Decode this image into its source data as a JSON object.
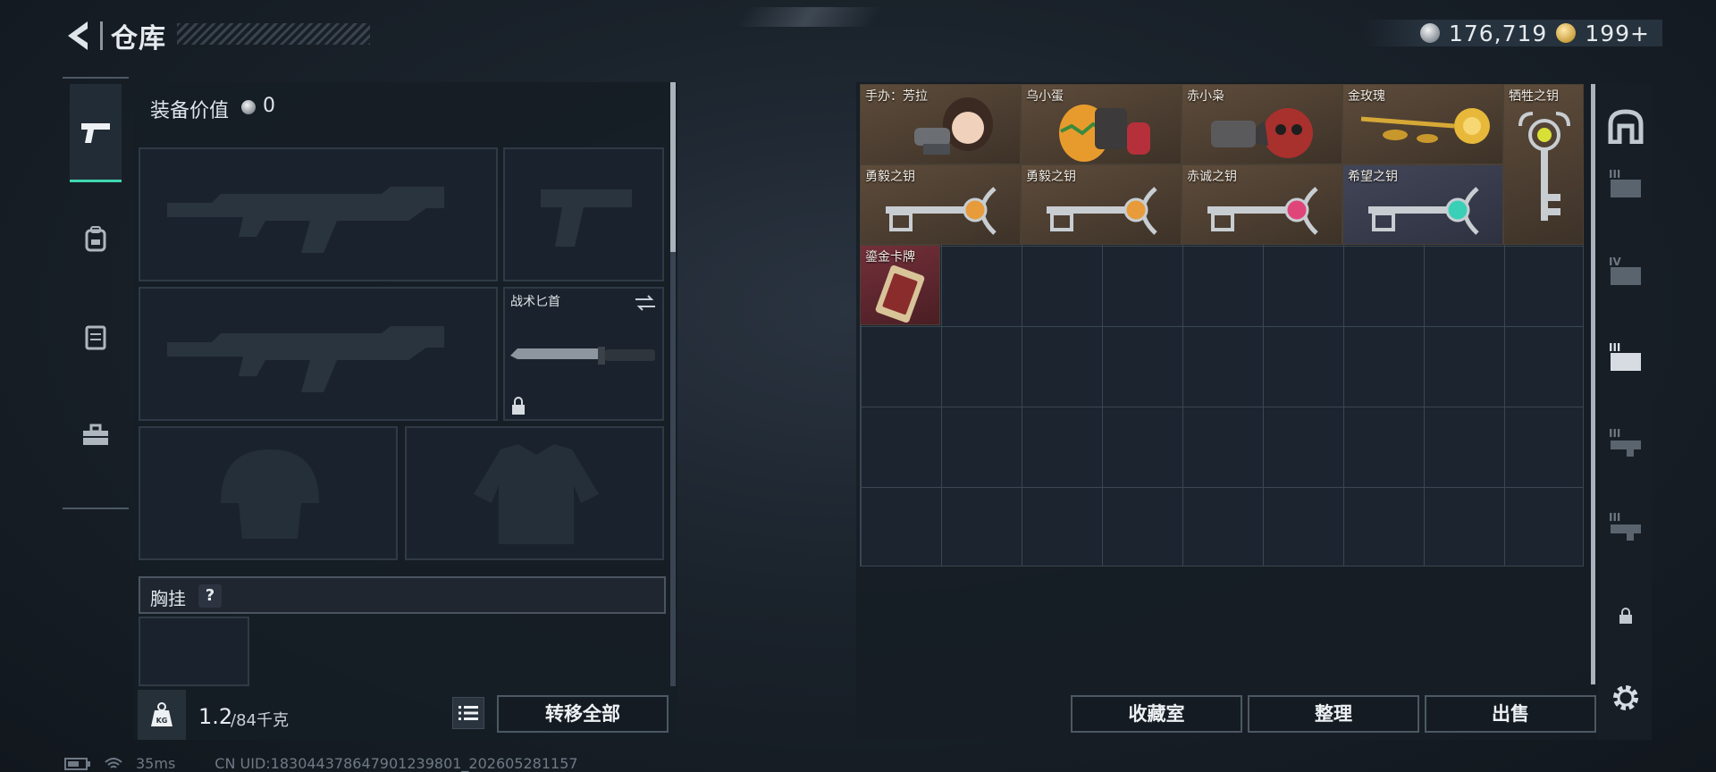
{
  "header": {
    "title": "仓库",
    "currency_silver": "176,719",
    "currency_gold": "199+"
  },
  "left_rail": {
    "tabs": [
      {
        "icon": "pistol-icon",
        "active": true
      },
      {
        "icon": "backpack-icon",
        "active": false
      },
      {
        "icon": "vest-icon",
        "active": false
      },
      {
        "icon": "toolbox-icon",
        "active": false
      }
    ]
  },
  "equipment": {
    "value_label": "装备价值",
    "value": "0",
    "slots": [
      {
        "name": "primary-weapon-slot-1",
        "label": ""
      },
      {
        "name": "pistol-slot",
        "label": ""
      },
      {
        "name": "primary-weapon-slot-2",
        "label": ""
      },
      {
        "name": "melee-slot",
        "label": "战术匕首"
      },
      {
        "name": "helmet-slot",
        "label": ""
      },
      {
        "name": "armor-slot",
        "label": ""
      }
    ],
    "vest_label": "胸挂",
    "vest_help": "?",
    "weight_current": "1.2",
    "weight_max": "/84千克",
    "transfer_all": "转移全部"
  },
  "storage": {
    "items": [
      {
        "name": "手办：芳拉",
        "color": "#5b4a3a"
      },
      {
        "name": "乌小蛋",
        "color": "#5b4a3a"
      },
      {
        "name": "赤小枭",
        "color": "#5b4a3a"
      },
      {
        "name": "金玫瑰",
        "color": "#5b4a3a"
      },
      {
        "name": "牺牲之钥",
        "color": "#5b4a3a"
      },
      {
        "name": "勇毅之钥",
        "color": "#5b4a3a"
      },
      {
        "name": "勇毅之钥",
        "color": "#5b4a3a"
      },
      {
        "name": "赤诚之钥",
        "color": "#5b4a3a"
      },
      {
        "name": "希望之钥",
        "color": "#3f4456"
      },
      {
        "name": "鎏金卡牌",
        "color": "#6e2a30"
      }
    ],
    "buttons": {
      "collection": "收藏室",
      "organize": "整理",
      "sell": "出售"
    }
  },
  "right_rail": {
    "icons": [
      "storage-arch-icon",
      "tier3-hand-icon",
      "tier4-folder-icon",
      "tier3-hand-gesture-icon",
      "tier3-gun-icon",
      "tier3-rifle-icon",
      "lock-icon",
      "settings-gear-icon"
    ],
    "tier_labels": [
      "III",
      "IV",
      "III",
      "III",
      "III"
    ]
  },
  "status": {
    "ping": "35ms",
    "uid": "CN UID:18304437864790123​9801_202605281157"
  }
}
